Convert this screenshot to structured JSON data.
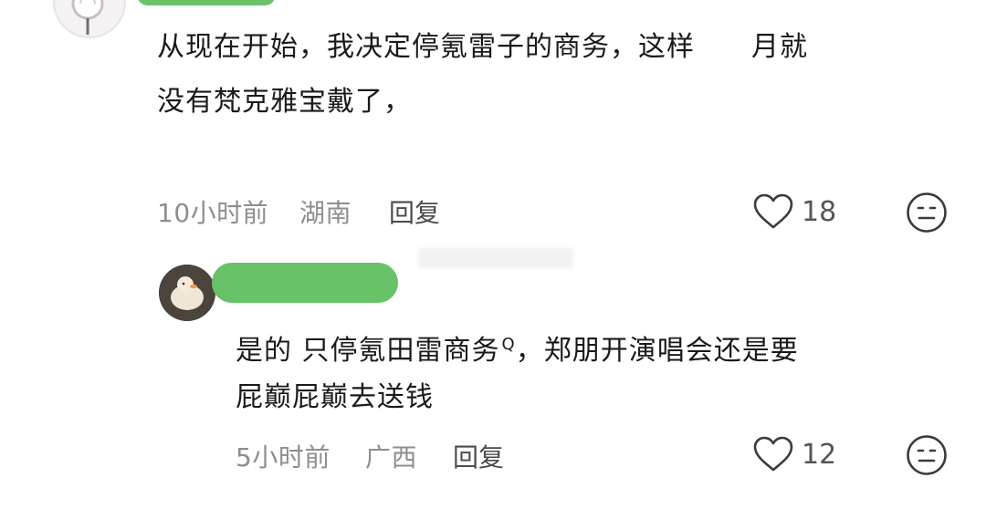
{
  "comment1": {
    "text_line1": "从现在开始，我决定停氪雷子的商务，这样",
    "text_line1_tail": "月就",
    "text_line2": "没有梵克雅宝戴了，",
    "time": "10小时前",
    "location": "湖南",
    "reply_label": "回复",
    "likes": "18",
    "icons": {
      "like": "heart-outline-icon",
      "reaction": "neutral-face-icon"
    }
  },
  "comment2": {
    "text_line1": "是的 只停氪田雷商务",
    "text_line1_rest": "，郑朋开演唱会还是要",
    "text_line2": "屁巅屁巅去送钱",
    "search_mark": "Q",
    "time": "5小时前",
    "location": "广西",
    "reply_label": "回复",
    "likes": "12",
    "icons": {
      "like": "heart-outline-icon",
      "reaction": "neutral-face-icon"
    }
  },
  "colors": {
    "name_highlight": "#6cc36a",
    "meta_text": "#8e8e8e",
    "body_text": "#1a1a1a"
  }
}
